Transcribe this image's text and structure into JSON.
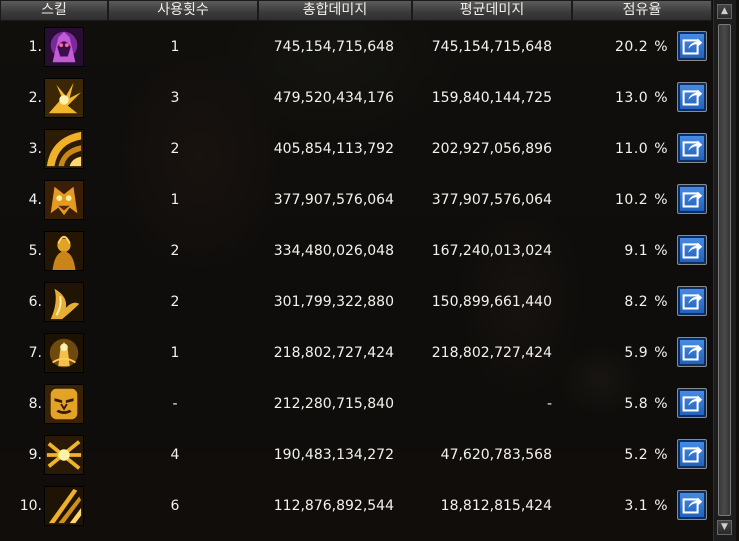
{
  "headers": {
    "skill": "스킬",
    "count": "사용횟수",
    "total": "총합데미지",
    "average": "평균데미지",
    "share": "점유율"
  },
  "percent_sign": "%",
  "rows": [
    {
      "rank": "1.",
      "icon": "dark-demon-skill-icon",
      "count": "1",
      "total": "745,154,715,648",
      "average": "745,154,715,648",
      "share": "20.2"
    },
    {
      "rank": "2.",
      "icon": "golden-slash-burst-icon",
      "count": "3",
      "total": "479,520,434,176",
      "average": "159,840,144,725",
      "share": "13.0"
    },
    {
      "rank": "3.",
      "icon": "golden-arc-sweep-icon",
      "count": "2",
      "total": "405,854,113,792",
      "average": "202,927,056,896",
      "share": "11.0"
    },
    {
      "rank": "4.",
      "icon": "golden-beast-mask-icon",
      "count": "1",
      "total": "377,907,576,064",
      "average": "377,907,576,064",
      "share": "10.2"
    },
    {
      "rank": "5.",
      "icon": "golden-figure-icon",
      "count": "2",
      "total": "334,480,026,048",
      "average": "167,240,013,024",
      "share": "9.1"
    },
    {
      "rank": "6.",
      "icon": "golden-claw-icon",
      "count": "2",
      "total": "301,799,322,880",
      "average": "150,899,661,440",
      "share": "8.2"
    },
    {
      "rank": "7.",
      "icon": "golden-flame-figure-icon",
      "count": "1",
      "total": "218,802,727,424",
      "average": "218,802,727,424",
      "share": "5.9"
    },
    {
      "rank": "8.",
      "icon": "golden-face-icon",
      "count": "-",
      "total": "212,280,715,840",
      "average": "-",
      "share": "5.8"
    },
    {
      "rank": "9.",
      "icon": "golden-cross-strike-icon",
      "count": "4",
      "total": "190,483,134,272",
      "average": "47,620,783,568",
      "share": "5.2"
    },
    {
      "rank": "10.",
      "icon": "golden-triple-slash-icon",
      "count": "6",
      "total": "112,876,892,544",
      "average": "18,812,815,424",
      "share": "3.1"
    }
  ],
  "colors": {
    "header_bg": "#4a4a4a",
    "share_button": "#2f74d0",
    "icon_gold": "#e0a92a"
  }
}
